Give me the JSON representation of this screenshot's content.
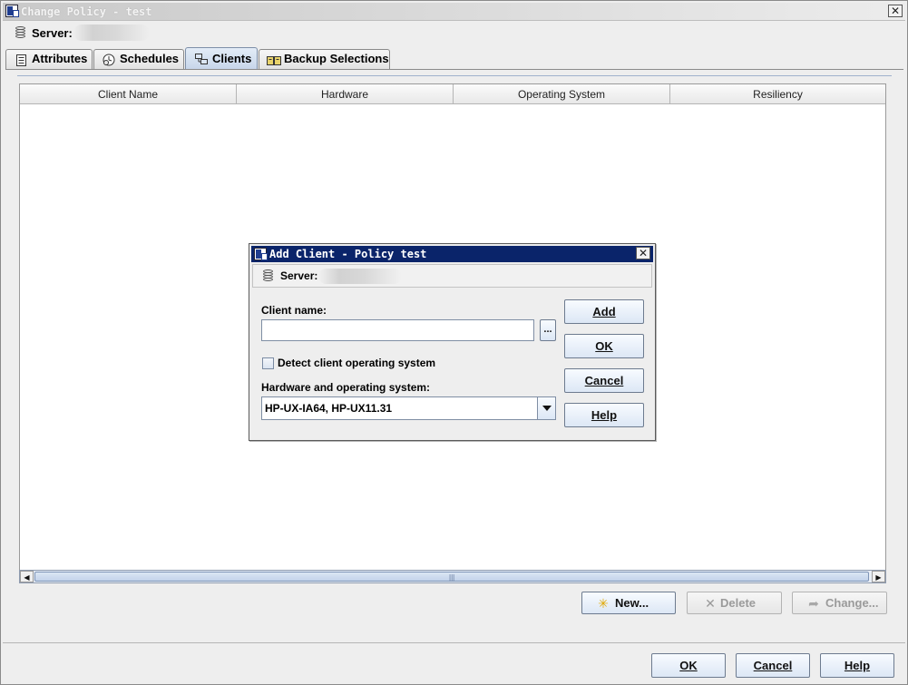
{
  "window": {
    "title": "Change Policy - test",
    "close_glyph": "✕",
    "server_label": "Server:"
  },
  "tabs": [
    {
      "label": "Attributes",
      "icon": "attributes-icon"
    },
    {
      "label": "Schedules",
      "icon": "schedules-icon"
    },
    {
      "label": "Clients",
      "icon": "clients-icon",
      "active": true
    },
    {
      "label": "Backup Selections",
      "icon": "backup-selections-icon"
    }
  ],
  "table": {
    "columns": [
      "Client Name",
      "Hardware",
      "Operating System",
      "Resiliency"
    ],
    "rows": []
  },
  "list_buttons": {
    "new_label": "New...",
    "delete_label": "Delete",
    "change_label": "Change..."
  },
  "footer_buttons": {
    "ok_label": "OK",
    "cancel_label": "Cancel",
    "help_label": "Help"
  },
  "dialog": {
    "title": "Add Client - Policy test",
    "close_glyph": "✕",
    "server_label": "Server:",
    "client_name_label": "Client name:",
    "client_name_value": "",
    "browse_label": "...",
    "detect_os_label": "Detect client operating system",
    "detect_os_checked": false,
    "hw_os_label": "Hardware and operating system:",
    "hw_os_value": "HP-UX-IA64, HP-UX11.31",
    "buttons": {
      "add_label": "Add",
      "ok_label": "OK",
      "cancel_label": "Cancel",
      "help_label": "Help"
    }
  },
  "colors": {
    "dialog_title_bg": "#0a246a",
    "window_bg": "#eeeeee",
    "button_border": "#6d7b8f"
  }
}
